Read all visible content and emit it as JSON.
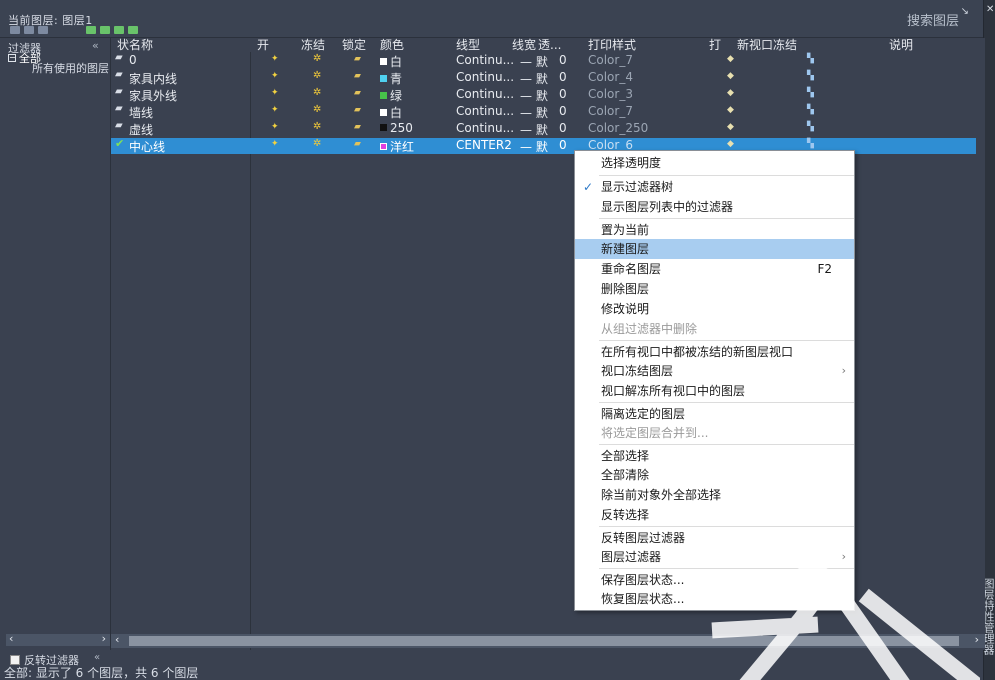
{
  "header": {
    "current_layer": "当前图层: 图层1",
    "search_placeholder": "搜索图层"
  },
  "side_title": "图层特性管理器",
  "filter_tree": {
    "header": "过滤器",
    "collapse": "«",
    "nodes": [
      {
        "label": "全部",
        "expanded": true
      },
      {
        "label": "所有使用的图层"
      }
    ],
    "invert_label": "反转过滤器",
    "invert_checked": false
  },
  "columns": {
    "status": "状",
    "name": "名称",
    "on": "开",
    "freeze": "冻结",
    "lock": "锁定",
    "color": "颜色",
    "linetype": "线型",
    "lineweight": "线宽",
    "transparency": "透...",
    "plotstyle": "打印样式",
    "plot": "打",
    "newvp": "新视口冻结",
    "desc": "说明"
  },
  "layers": [
    {
      "name": "0",
      "on": "✦",
      "freeze": "✲",
      "lock": "▰",
      "color_label": "白",
      "color_hex": "#ffffff",
      "linetype": "Continu...",
      "lineweight": "— 默",
      "transparency": "0",
      "plotstyle": "Color_7"
    },
    {
      "name": "家具内线",
      "on": "✦",
      "freeze": "✲",
      "lock": "▰",
      "color_label": "青",
      "color_hex": "#4fd0f0",
      "linetype": "Continu...",
      "lineweight": "— 默",
      "transparency": "0",
      "plotstyle": "Color_4"
    },
    {
      "name": "家具外线",
      "on": "✦",
      "freeze": "✲",
      "lock": "▰",
      "color_label": "绿",
      "color_hex": "#47c44a",
      "linetype": "Continu...",
      "lineweight": "— 默",
      "transparency": "0",
      "plotstyle": "Color_3"
    },
    {
      "name": "墙线",
      "on": "✦",
      "freeze": "✲",
      "lock": "▰",
      "color_label": "白",
      "color_hex": "#ffffff",
      "linetype": "Continu...",
      "lineweight": "— 默",
      "transparency": "0",
      "plotstyle": "Color_7"
    },
    {
      "name": "虚线",
      "on": "✦",
      "freeze": "✲",
      "lock": "▰",
      "color_label": "250",
      "color_hex": "#111111",
      "linetype": "Continu...",
      "lineweight": "— 默",
      "transparency": "0",
      "plotstyle": "Color_250"
    },
    {
      "name": "中心线",
      "on": "✦",
      "freeze": "✲",
      "lock": "▰",
      "color_label": "洋红",
      "color_hex": "#e040e0",
      "linetype": "CENTER2",
      "lineweight": "— 默",
      "transparency": "0",
      "plotstyle": "Color_6",
      "current": true,
      "selected": true
    }
  ],
  "context_menu": {
    "items": [
      {
        "label": "选择透明度"
      },
      {
        "label": "显示过滤器树",
        "checked": true
      },
      {
        "label": "显示图层列表中的过滤器"
      },
      {
        "label": "置为当前"
      },
      {
        "label": "新建图层",
        "highlighted": true
      },
      {
        "label": "重命名图层",
        "shortcut": "F2"
      },
      {
        "label": "删除图层"
      },
      {
        "label": "修改说明"
      },
      {
        "label": "从组过滤器中删除",
        "disabled": true
      },
      {
        "label": "在所有视口中都被冻结的新图层视口"
      },
      {
        "label": "视口冻结图层",
        "submenu": true
      },
      {
        "label": "视口解冻所有视口中的图层"
      },
      {
        "label": "隔离选定的图层"
      },
      {
        "label": "将选定图层合并到...",
        "disabled": true
      },
      {
        "label": "全部选择"
      },
      {
        "label": "全部清除"
      },
      {
        "label": "除当前对象外全部选择"
      },
      {
        "label": "反转选择"
      },
      {
        "label": "反转图层过滤器"
      },
      {
        "label": "图层过滤器",
        "submenu": true
      },
      {
        "label": "保存图层状态..."
      },
      {
        "label": "恢复图层状态..."
      }
    ]
  },
  "status_text": "全部: 显示了 6 个图层，共 6 个图层",
  "colors": {
    "panel_bg": "#3a4150",
    "selection": "#2f8ed3",
    "menu_highlight": "#a8cdf0"
  }
}
